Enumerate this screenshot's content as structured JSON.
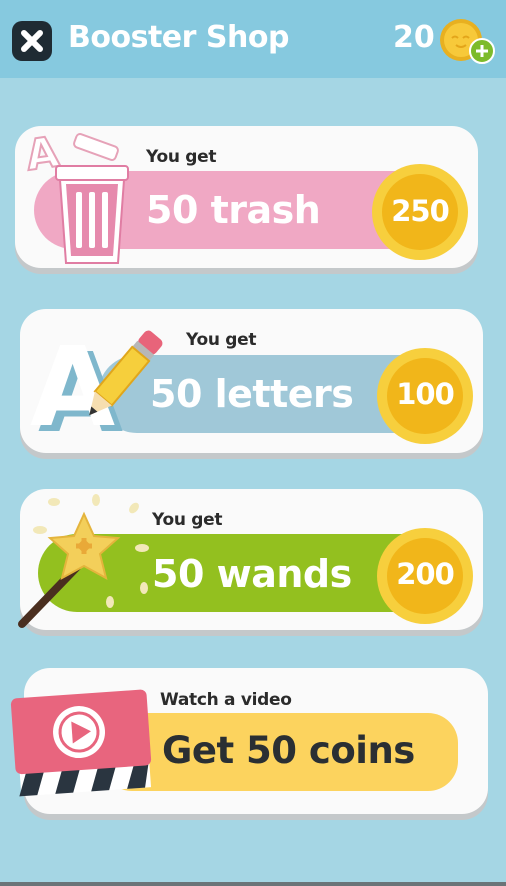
{
  "header": {
    "title": "Booster Shop",
    "coin_count": "20"
  },
  "offers": [
    {
      "caption": "You get",
      "label": "50 trash",
      "price": "250",
      "bar_color": "#f0a8c4"
    },
    {
      "caption": "You get",
      "label": "50 letters",
      "price": "100",
      "bar_color": "#a0c8d8"
    },
    {
      "caption": "You get",
      "label": "50 wands",
      "price": "200",
      "bar_color": "#93c01f"
    }
  ],
  "video_offer": {
    "caption": "Watch a video",
    "label": "Get 50 coins",
    "bar_color": "#fcd35e"
  },
  "colors": {
    "background": "#a5d6e4",
    "header": "#86c9df",
    "coin": "#f5c32c"
  },
  "icons": [
    "close-icon",
    "coin-icon",
    "plus-icon",
    "trash-can-icon",
    "letter-a-icon",
    "pencil-icon",
    "magic-wand-icon",
    "video-clapper-icon",
    "play-icon"
  ]
}
